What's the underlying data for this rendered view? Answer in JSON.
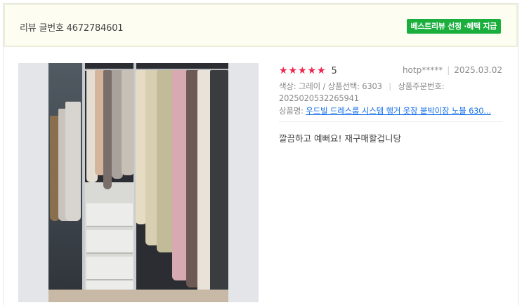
{
  "header": {
    "title": "리뷰 글번호 4672784601",
    "badge": "베스트리뷰 선정 ·혜택 지급"
  },
  "review": {
    "rating": 5,
    "rating_label": "5",
    "max_rating": 5,
    "star_color": "#f0244d",
    "author": "hotp*****",
    "date": "2025.03.02",
    "option_line": "색상: 그레이 / 상품선택: 6303",
    "order_label": "상품주문번호:",
    "order_number": "2025020532265941",
    "product_prefix": "상품명: ",
    "product_name": "우드빌 드레스룸 시스템 행거 옷장 붙박이장 노블 630...",
    "text": "깔끔하고 예뻐요! 재구매할겁니당"
  },
  "colors": {
    "badge_green": "#1aae3d",
    "header_bg": "#fdfdf2",
    "link_blue": "#1a73e8"
  }
}
